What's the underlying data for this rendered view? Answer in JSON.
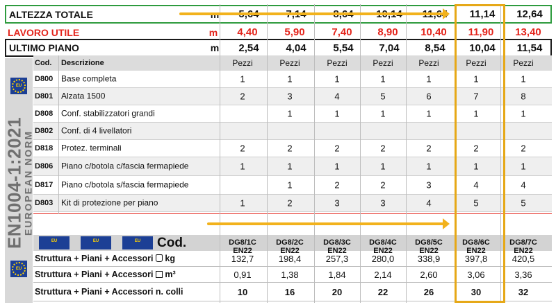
{
  "header_rows": [
    {
      "label": "ALTEZZA TOTALE",
      "unit": "m",
      "values": [
        "5,64",
        "7,14",
        "8,64",
        "10,14",
        "11,64",
        "11,14",
        "12,64"
      ]
    },
    {
      "label": "LAVORO UTILE",
      "unit": "m",
      "values": [
        "4,40",
        "5,90",
        "7,40",
        "8,90",
        "10,40",
        "11,90",
        "13,40"
      ]
    },
    {
      "label": "ULTIMO PIANO",
      "unit": "m",
      "values": [
        "2,54",
        "4,04",
        "5,54",
        "7,04",
        "8,54",
        "10,04",
        "11,54"
      ]
    }
  ],
  "side_panel": {
    "norm": "EN1004-1:2021",
    "subtitle": "EUROPEAN NORM",
    "badge": "EU"
  },
  "parts_table": {
    "code_header": "Cod.",
    "desc_header": "Descrizione",
    "qty_header": "Pezzi",
    "rows": [
      {
        "code": "D800",
        "desc": "Base completa",
        "qty": [
          "1",
          "1",
          "1",
          "1",
          "1",
          "1",
          "1"
        ]
      },
      {
        "code": "D801",
        "desc": "Alzata 1500",
        "qty": [
          "2",
          "3",
          "4",
          "5",
          "6",
          "7",
          "8"
        ]
      },
      {
        "code": "D808",
        "desc": "Conf. stabilizzatori grandi",
        "qty": [
          "",
          "1",
          "1",
          "1",
          "1",
          "1",
          "1"
        ]
      },
      {
        "code": "D802",
        "desc": "Conf. di 4 livellatori",
        "qty": [
          "",
          "",
          "",
          "",
          "",
          "",
          ""
        ]
      },
      {
        "code": "D818",
        "desc": "Protez. terminali",
        "qty": [
          "2",
          "2",
          "2",
          "2",
          "2",
          "2",
          "2"
        ]
      },
      {
        "code": "D806",
        "desc": "Piano c/botola c/fascia fermapiede",
        "qty": [
          "1",
          "1",
          "1",
          "1",
          "1",
          "1",
          "1"
        ]
      },
      {
        "code": "D817",
        "desc": "Piano c/botola s/fascia fermapiede",
        "qty": [
          "",
          "1",
          "2",
          "2",
          "3",
          "4",
          "4"
        ]
      },
      {
        "code": "D803",
        "desc": "Kit di protezione per piano",
        "qty": [
          "1",
          "2",
          "3",
          "3",
          "4",
          "5",
          "5"
        ]
      }
    ]
  },
  "model_table": {
    "cod_label": "Cod.",
    "badge": "EU",
    "codes": [
      "DG8/1C EN22",
      "DG8/2C EN22",
      "DG8/3C EN22",
      "DG8/4C EN22",
      "DG8/5C EN22",
      "DG8/6C EN22",
      "DG8/7C EN22"
    ],
    "rows": [
      {
        "label": "Struttura + Piani + Accessori",
        "unit": "kg",
        "icon": "weight-icon",
        "values": [
          "132,7",
          "198,4",
          "257,3",
          "280,0",
          "338,9",
          "397,8",
          "420,5"
        ]
      },
      {
        "label": "Struttura + Piani + Accessori",
        "unit": "m³",
        "icon": "cube-icon",
        "values": [
          "0,91",
          "1,38",
          "1,84",
          "2,14",
          "2,60",
          "3,06",
          "3,36"
        ]
      },
      {
        "label": "Struttura + Piani + Accessori n. colli",
        "unit": "",
        "icon": "",
        "values": [
          "10",
          "16",
          "20",
          "22",
          "26",
          "30",
          "32"
        ]
      }
    ]
  },
  "colors": {
    "green_border": "#2e9b3e",
    "red_text": "#e3241b",
    "highlight": "#e6a817",
    "arrow": "#f2b21c",
    "eu_blue": "#1c3f95"
  }
}
